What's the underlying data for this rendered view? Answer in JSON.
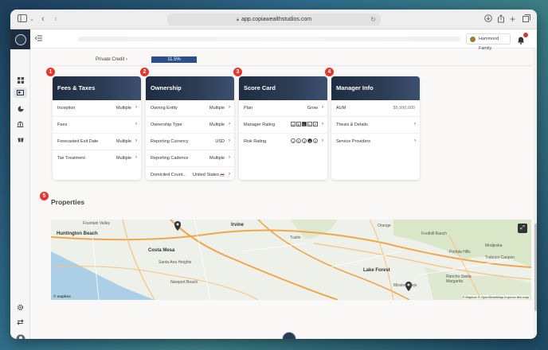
{
  "browser": {
    "url": "app.copiawealthstudios.com"
  },
  "header": {
    "family_label": "Hammond Family"
  },
  "private_credit": {
    "label": "Private Credit",
    "value": "11.5%",
    "fill_fraction": 1.0
  },
  "badges": [
    "1",
    "2",
    "3",
    "4",
    "5"
  ],
  "cards": {
    "fees": {
      "title": "Fees & Taxes",
      "rows": [
        {
          "label": "Inception",
          "value": "Multiple"
        },
        {
          "label": "Fees",
          "value": ""
        },
        {
          "label": "Forecasted Exit Date",
          "value": "Multiple"
        },
        {
          "label": "Tax Treatment",
          "value": "Multiple"
        }
      ]
    },
    "ownership": {
      "title": "Ownership",
      "rows": [
        {
          "label": "Owning Entity",
          "value": "Multiple"
        },
        {
          "label": "Ownership Type",
          "value": "Multiple"
        },
        {
          "label": "Reporting Currency",
          "value": "USD"
        },
        {
          "label": "Reporting Cadence",
          "value": "Multiple"
        },
        {
          "label": "Domiciled Count...",
          "value": "United States"
        }
      ]
    },
    "scorecard": {
      "title": "Score Card",
      "plan_label": "Plan",
      "plan_value": "Grow",
      "manager_rating_label": "Manager Rating",
      "manager_rating_options": [
        "A",
        "B",
        "C",
        "D",
        "F"
      ],
      "manager_rating_selected": "C",
      "risk_rating_label": "Risk Rating",
      "risk_rating_options": [
        "1",
        "2",
        "3",
        "4",
        "5"
      ],
      "risk_rating_selected": "4"
    },
    "manager": {
      "title": "Manager Info",
      "rows": [
        {
          "label": "AUM",
          "value": "$5,990,000"
        },
        {
          "label": "Thesis & Details",
          "value": ""
        },
        {
          "label": "Service Providers",
          "value": ""
        }
      ]
    }
  },
  "properties": {
    "title": "Properties",
    "map_labels": {
      "huntington_beach": "Huntington Beach",
      "costa_mesa": "Costa Mesa",
      "irvine": "Irvine",
      "lake_forest": "Lake Forest",
      "rancho": "Rancho Santa Margarita",
      "fountain_valley": "Fountain Valley",
      "santa_ana_heights": "Santa Ana Heights",
      "newport_beach": "Newport Beach",
      "tustin": "Tustin",
      "orange": "Orange",
      "lake_forest_west": "Mission Viejo",
      "portola": "Portola Hills",
      "foothill": "Foothill Ranch",
      "modjeska": "Modjeska",
      "trabuco": "Trabuco Canyon"
    },
    "attribution": "© Mapbox © OpenStreetMap Improve this map",
    "mapbox": "© mapbox"
  },
  "colors": {
    "header_navy": "#1f2d42",
    "badge_red": "#e6362e",
    "bar_blue": "#2a4e8e"
  }
}
